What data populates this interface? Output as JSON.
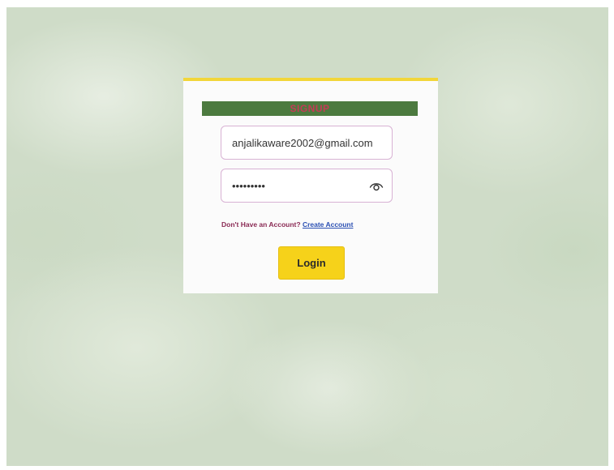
{
  "login_form": {
    "header_title": "SIGNUP",
    "email_value": "anjalikaware2002@gmail.com",
    "password_value": "•••••••••",
    "password_toggle_icon": "eye-icon",
    "account_prompt": "Don't Have an Account?",
    "create_account_link": "Create Account",
    "login_button_label": "Login"
  },
  "colors": {
    "accent_border": "#f2d63a",
    "header_bg": "#4c7a3f",
    "header_text": "#c43a55",
    "button_bg": "#f6d21a",
    "link": "#2a4fb3",
    "prompt_text": "#8a2a54",
    "input_border": "#d8b2d4"
  }
}
